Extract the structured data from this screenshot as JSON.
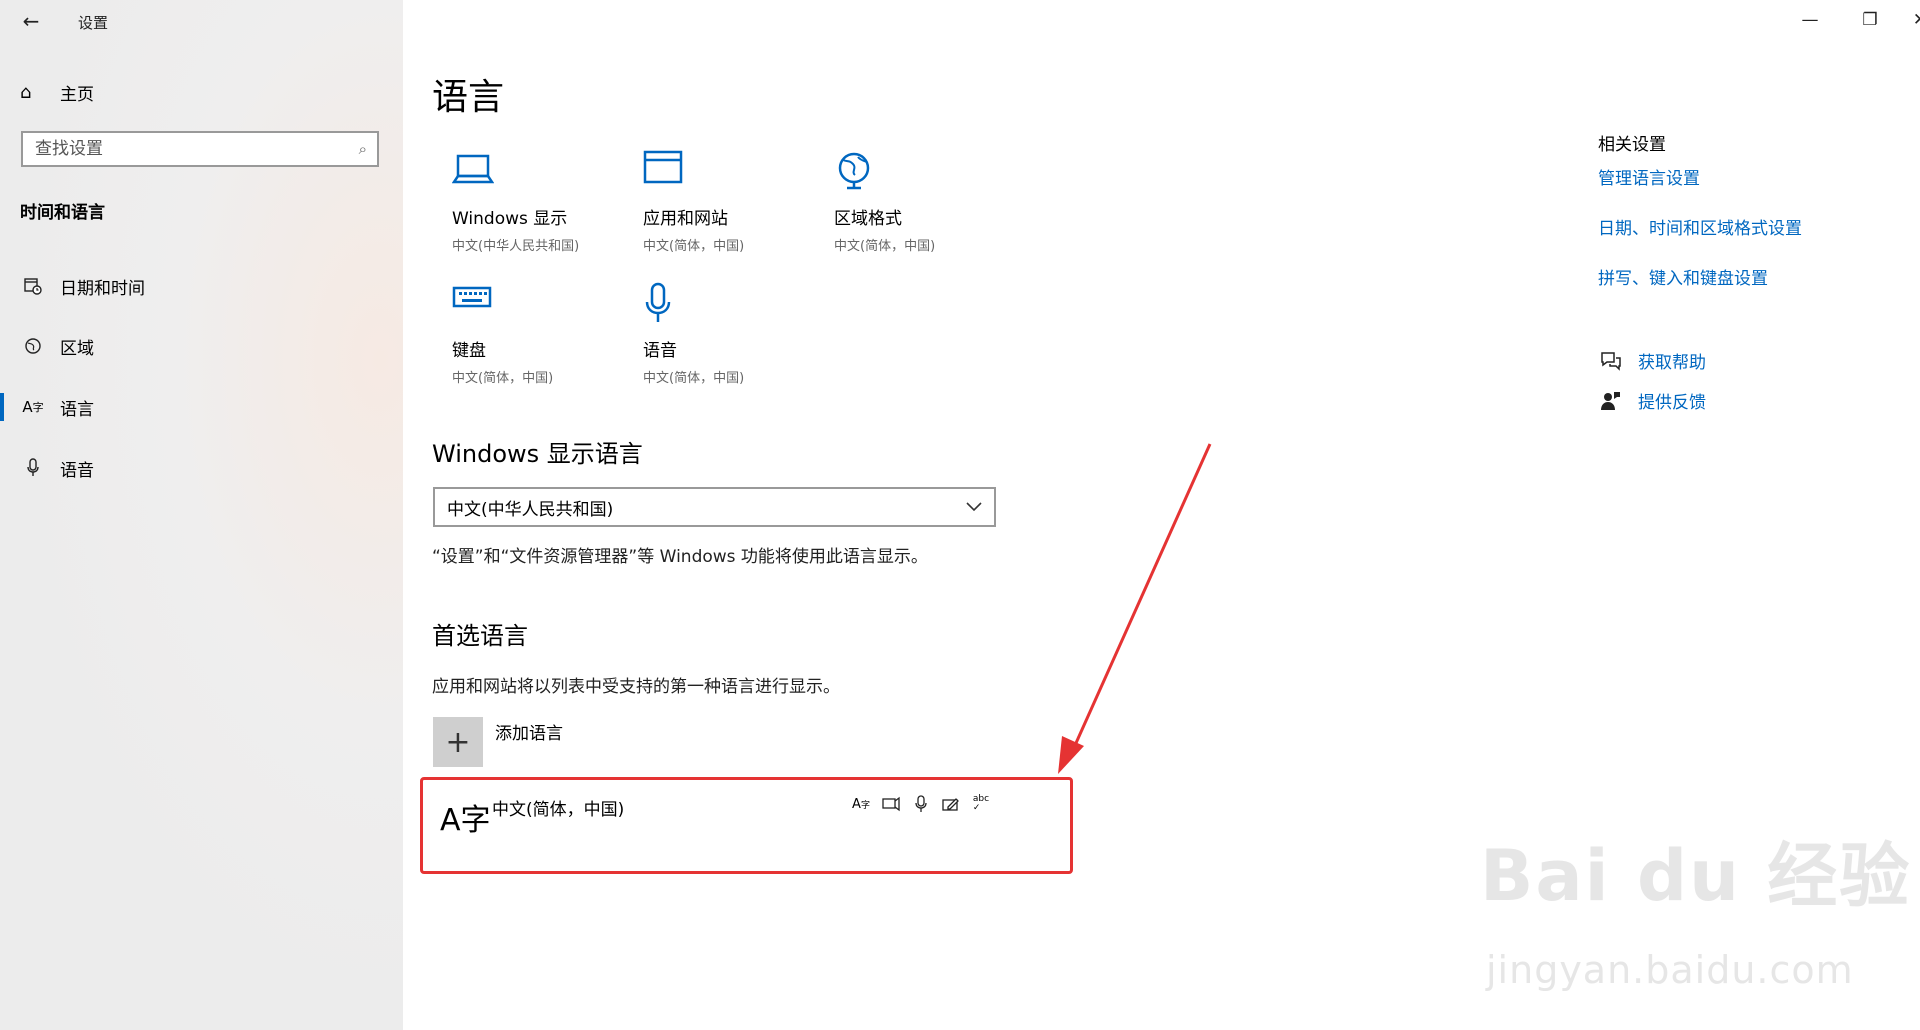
{
  "window": {
    "title": "设置",
    "minimize": "—",
    "maximize": "❐",
    "close": "✕"
  },
  "sidebar": {
    "home_label": "主页",
    "search_placeholder": "查找设置",
    "section_title": "时间和语言",
    "items": [
      {
        "label": "日期和时间",
        "icon": "calendar-clock-icon"
      },
      {
        "label": "区域",
        "icon": "globe-icon"
      },
      {
        "label": "语言",
        "icon": "language-icon",
        "active": true
      },
      {
        "label": "语音",
        "icon": "microphone-icon"
      }
    ]
  },
  "main": {
    "title": "语言",
    "tiles": [
      {
        "label": "Windows 显示",
        "sub": "中文(中华人民共和国)",
        "icon": "laptop-icon"
      },
      {
        "label": "应用和网站",
        "sub": "中文(简体，中国)",
        "icon": "window-icon"
      },
      {
        "label": "区域格式",
        "sub": "中文(简体，中国)",
        "icon": "globe-format-icon"
      },
      {
        "label": "键盘",
        "sub": "中文(简体，中国)",
        "icon": "keyboard-icon"
      },
      {
        "label": "语音",
        "sub": "中文(简体，中国)",
        "icon": "microphone-icon"
      }
    ],
    "display_language": {
      "heading": "Windows 显示语言",
      "selected": "中文(中华人民共和国)",
      "note": "“设置”和“文件资源管理器”等 Windows 功能将使用此语言显示。"
    },
    "preferred": {
      "heading": "首选语言",
      "note": "应用和网站将以列表中受支持的第一种语言进行显示。",
      "add_label": "添加语言",
      "languages": [
        {
          "name": "中文(简体，中国)",
          "icon": "A字"
        }
      ]
    }
  },
  "related": {
    "title": "相关设置",
    "links": [
      "管理语言设置",
      "日期、时间和区域格式设置",
      "拼写、键入和键盘设置"
    ],
    "help": "获取帮助",
    "feedback": "提供反馈"
  },
  "watermark": {
    "main": "Bai du 经验",
    "sub": "jingyan.baidu.com"
  },
  "colors": {
    "accent": "#0067c0",
    "highlight": "#e53333"
  }
}
